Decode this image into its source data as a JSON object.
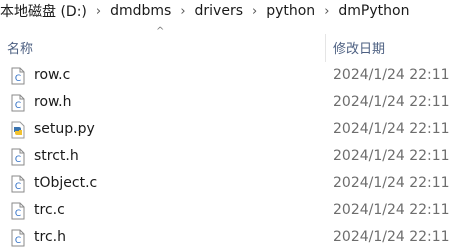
{
  "breadcrumb": {
    "items": [
      "本地磁盘 (D:)",
      "dmdbms",
      "drivers",
      "python",
      "dmPython"
    ],
    "separator": "›"
  },
  "sort_indicator": "^",
  "columns": {
    "name": "名称",
    "date_modified": "修改日期"
  },
  "files": [
    {
      "name": "row.c",
      "date": "2024/1/24 22:11",
      "icon": "c-source-file-icon"
    },
    {
      "name": "row.h",
      "date": "2024/1/24 22:11",
      "icon": "c-header-file-icon"
    },
    {
      "name": "setup.py",
      "date": "2024/1/24 22:11",
      "icon": "python-file-icon"
    },
    {
      "name": "strct.h",
      "date": "2024/1/24 22:11",
      "icon": "c-header-file-icon"
    },
    {
      "name": "tObject.c",
      "date": "2024/1/24 22:11",
      "icon": "c-source-file-icon"
    },
    {
      "name": "trc.c",
      "date": "2024/1/24 22:11",
      "icon": "c-source-file-icon"
    },
    {
      "name": "trc.h",
      "date": "2024/1/24 22:11",
      "icon": "c-header-file-icon"
    }
  ],
  "colors": {
    "header_text": "#4d6082",
    "date_text": "#6d6d6d",
    "icon_blue": "#2b6cc4"
  }
}
